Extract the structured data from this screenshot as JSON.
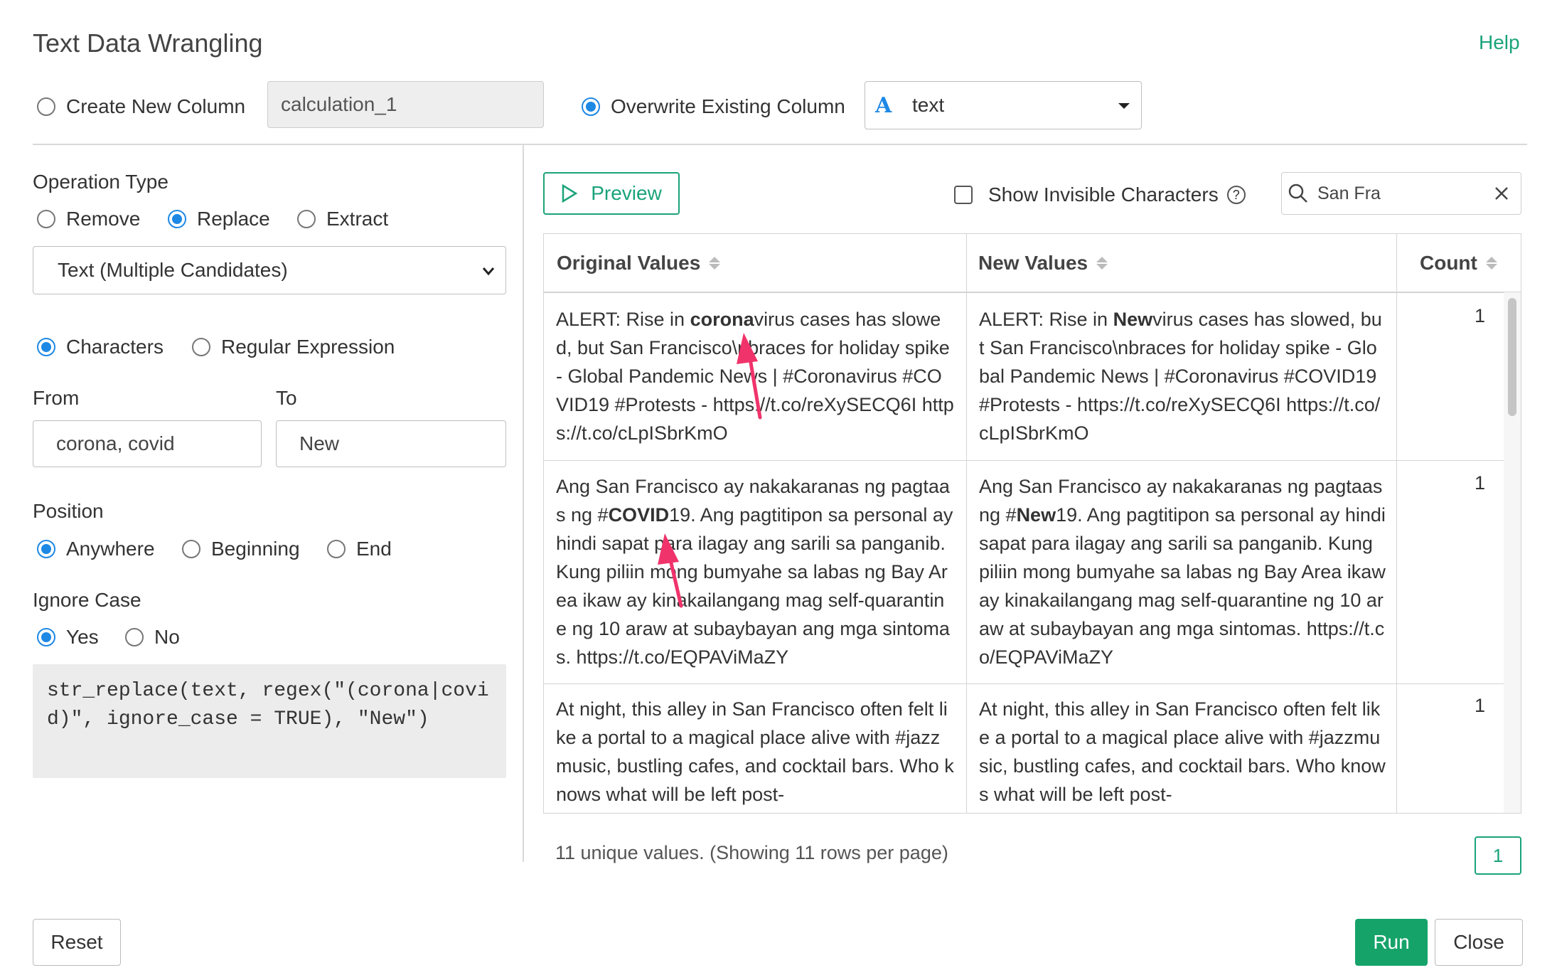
{
  "dialog": {
    "title": "Text Data Wrangling",
    "help_label": "Help"
  },
  "column_target": {
    "create_new_label": "Create New Column",
    "new_column_name": "calculation_1",
    "overwrite_label": "Overwrite Existing Column",
    "selected_column_type_glyph": "A",
    "selected_column": "text"
  },
  "operation": {
    "heading": "Operation Type",
    "types": [
      "Remove",
      "Replace",
      "Extract"
    ],
    "selected_type": "Replace",
    "mode_select": "Text (Multiple Candidates)",
    "match_types": [
      "Characters",
      "Regular Expression"
    ],
    "from_label": "From",
    "from_value": "corona, covid",
    "to_label": "To",
    "to_value": "New",
    "position_heading": "Position",
    "positions": [
      "Anywhere",
      "Beginning",
      "End"
    ],
    "ignore_case_heading": "Ignore Case",
    "ignore_case_options": [
      "Yes",
      "No"
    ],
    "code": "str_replace(text, regex(\"(corona|covid)\", ignore_case = TRUE), \"New\")"
  },
  "preview": {
    "button_label": "Preview",
    "show_invisible_label": "Show Invisible Characters",
    "help_glyph": "?",
    "search_value": "San Fra",
    "headers": {
      "original": "Original Values",
      "new": "New Values",
      "count": "Count"
    },
    "rows": [
      {
        "original_pre": "ALERT: Rise in ",
        "original_match": "corona",
        "original_post": "virus cases has slowed, but San Francisco\\nbraces for holiday spike - Global Pandemic News | #Coronavirus #COVID19 #Protests - https://t.co/reXySECQ6I https://t.co/cLpISbrKmO",
        "new_pre": "ALERT: Rise in ",
        "new_match": "New",
        "new_post": "virus cases has slowed, but San Francisco\\nbraces for holiday spike - Global Pandemic News | #Coronavirus #COVID19 #Protests - https://t.co/reXySECQ6I https://t.co/cLpISbrKmO",
        "count": "1"
      },
      {
        "original_pre": "Ang San Francisco ay nakakaranas ng pagtaas ng #",
        "original_match": "COVID",
        "original_post": "19. Ang pagtitipon sa personal ay hindi sapat para ilagay ang sarili sa panganib. Kung piliin mong bumyahe sa labas ng Bay Area ikaw ay kinakailangang mag self-quarantine ng 10 araw at subaybayan ang mga sintomas. https://t.co/EQPAViMaZY",
        "new_pre": "Ang San Francisco ay nakakaranas ng pagtaas ng #",
        "new_match": "New",
        "new_post": "19. Ang pagtitipon sa personal ay hindi sapat para ilagay ang sarili sa panganib. Kung piliin mong bumyahe sa labas ng Bay Area ikaw ay kinakailangang mag self-quarantine ng 10 araw at subaybayan ang mga sintomas. https://t.co/EQPAViMaZY",
        "count": "1"
      },
      {
        "original_text": "At night, this alley in San Francisco often felt like a portal to a magical place alive with #jazzmusic, bustling cafes, and cocktail bars. Who knows what will be left post-",
        "new_text": "At night, this alley in San Francisco often felt like a portal to a magical place alive with #jazzmusic, bustling cafes, and cocktail bars. Who knows what will be left post-",
        "count": "1"
      }
    ],
    "summary": "11 unique values. (Showing 11 rows per page)",
    "page": "1"
  },
  "footer": {
    "reset_label": "Reset",
    "run_label": "Run",
    "close_label": "Close"
  },
  "colors": {
    "accent_green": "#1aa37a",
    "radio_blue": "#1e88e5",
    "annotation_arrow": "#f0336b"
  }
}
